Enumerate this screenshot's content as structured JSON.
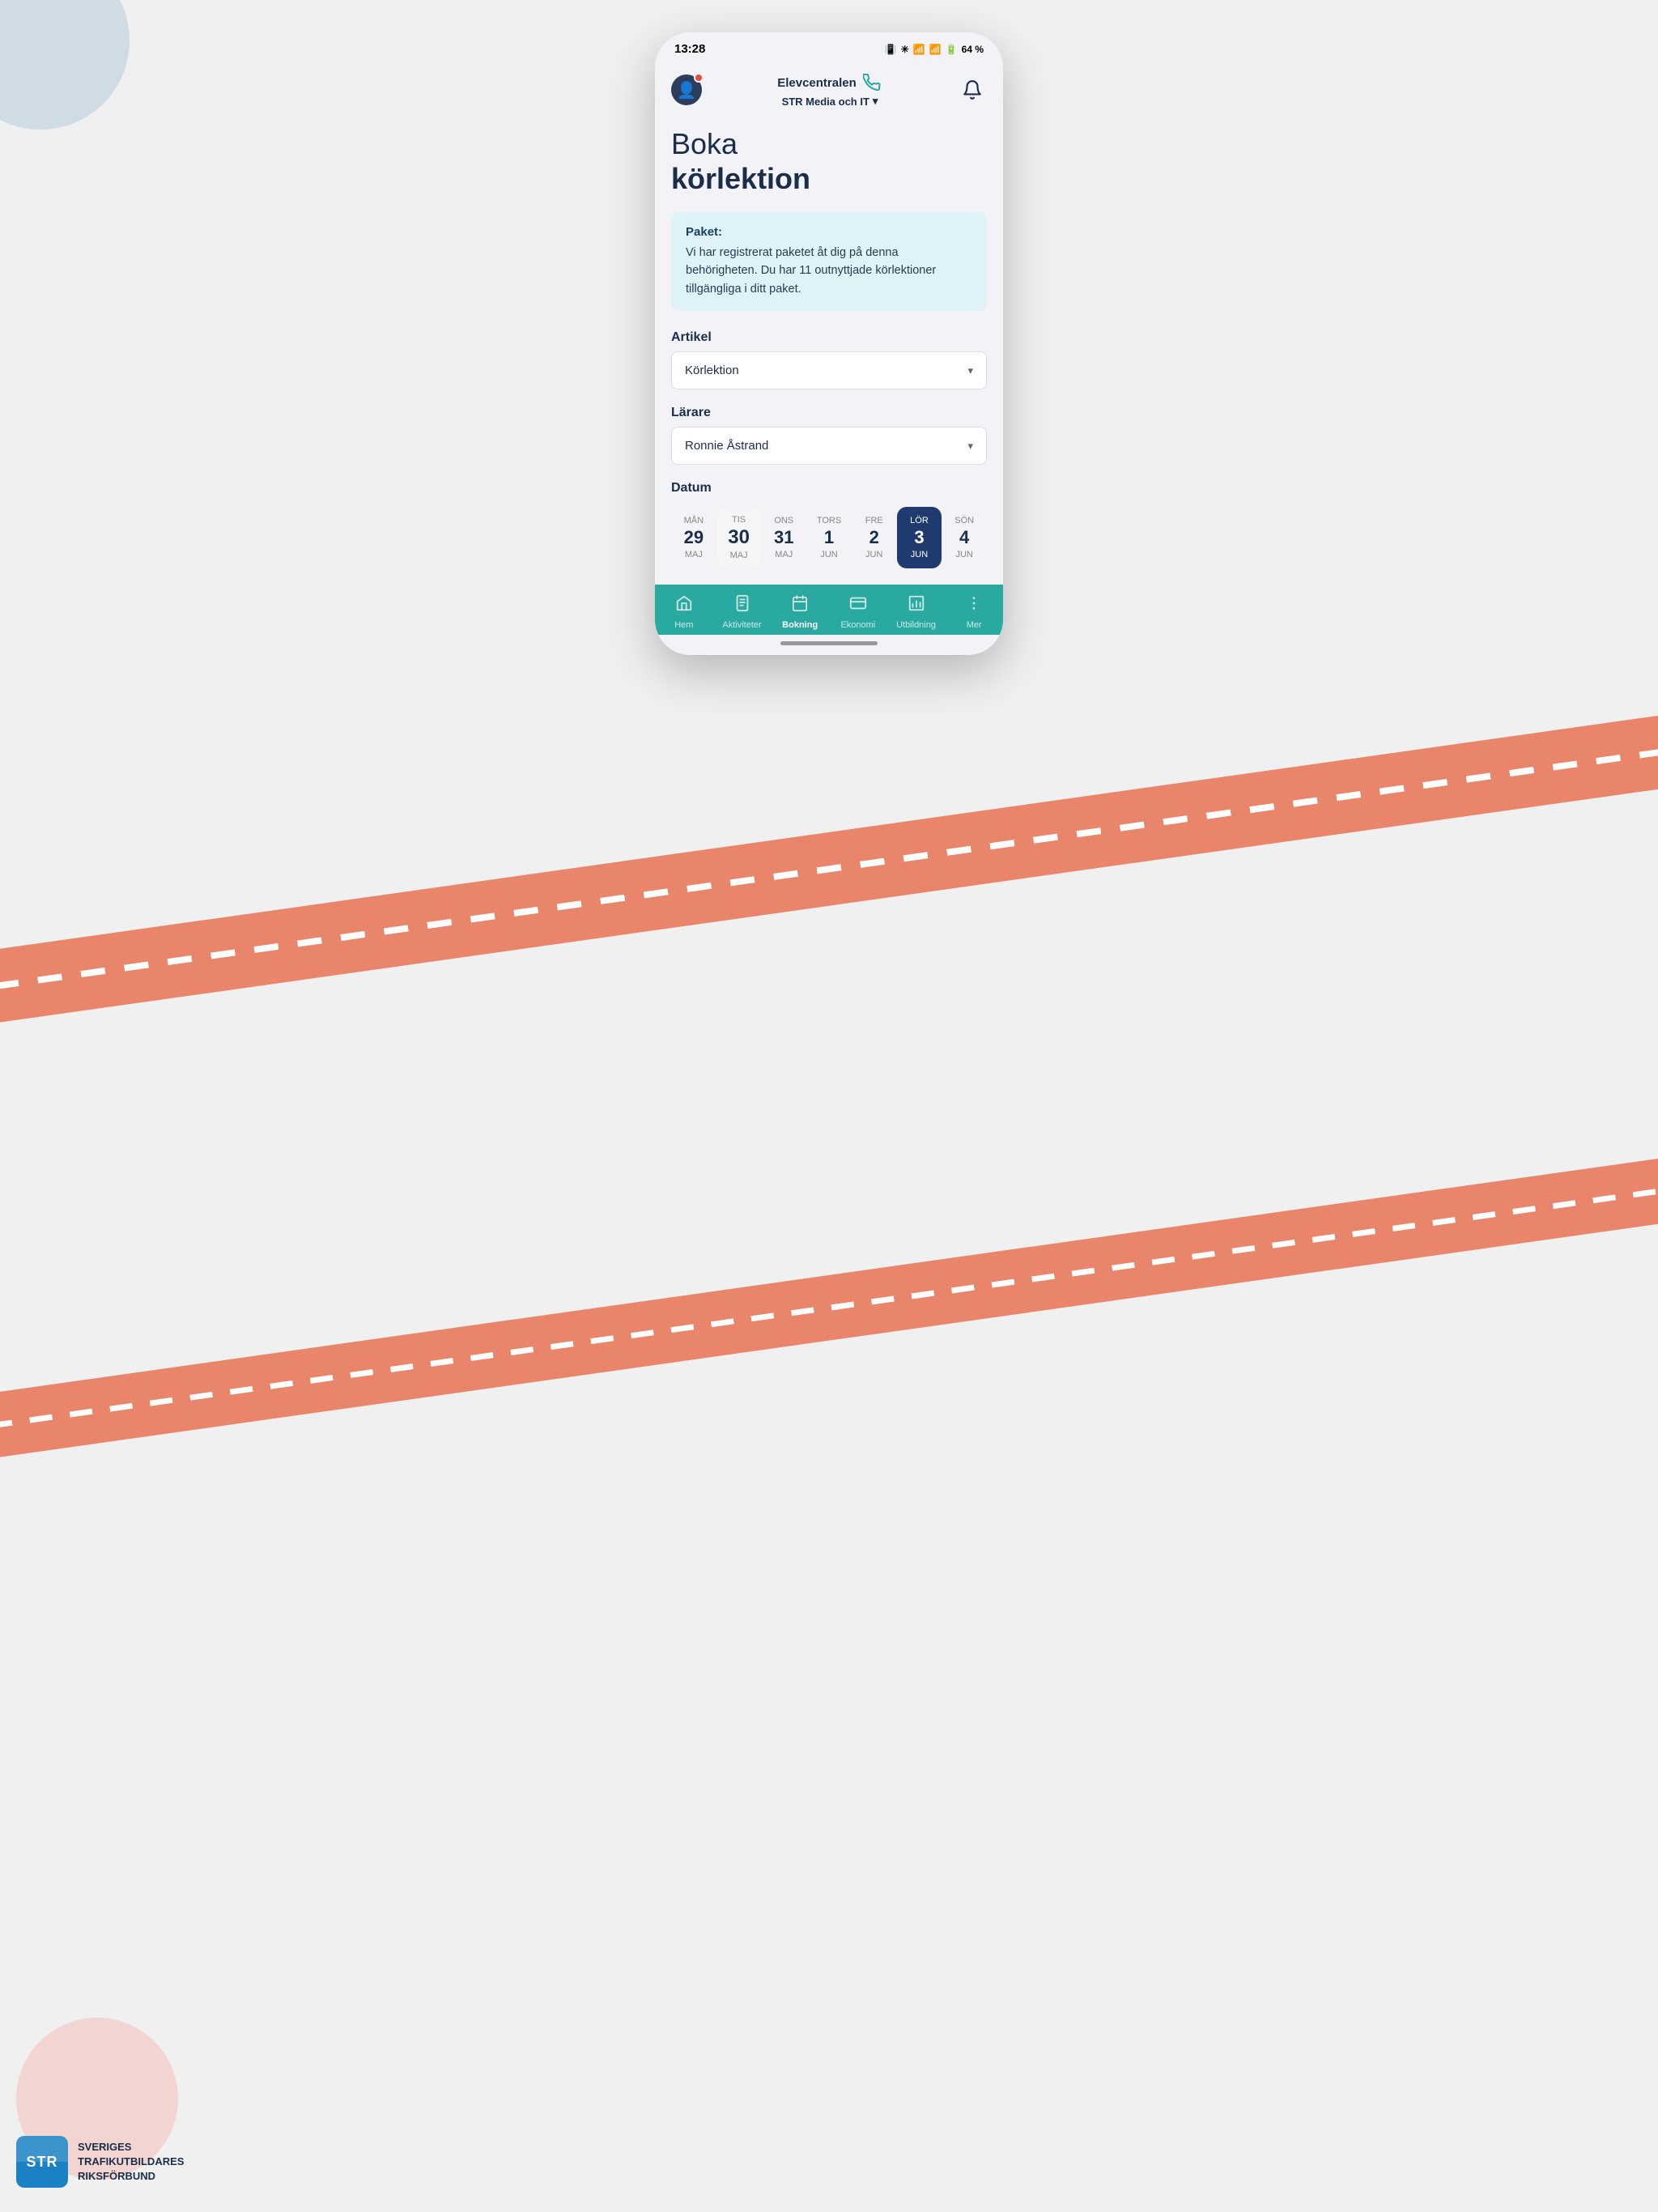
{
  "status_bar": {
    "time": "13:28",
    "battery": "64 %",
    "icons_text": "🔔 ✳ 📶 📶 🔋 64 %"
  },
  "top_nav": {
    "app_name": "Elevcentralen",
    "school_name": "STR Media och IT",
    "chevron": "∨"
  },
  "page": {
    "title_light": "Boka",
    "title_bold": "körlektion"
  },
  "info_box": {
    "title": "Paket:",
    "text": "Vi har registrerat paketet åt dig på denna behörigheten. Du har 11 outnyttjade körlektioner tillgängliga i ditt paket."
  },
  "form": {
    "article_label": "Artikel",
    "article_value": "Körlektion",
    "teacher_label": "Lärare",
    "teacher_value": "Ronnie Åstrand",
    "date_label": "Datum"
  },
  "calendar": {
    "days": [
      {
        "day_name": "MÅN",
        "num": "29",
        "month": "MAJ",
        "selected": false,
        "highlighted": false
      },
      {
        "day_name": "TIS",
        "num": "30",
        "month": "MAJ",
        "selected": false,
        "highlighted": true
      },
      {
        "day_name": "ONS",
        "num": "31",
        "month": "MAJ",
        "selected": false,
        "highlighted": false
      },
      {
        "day_name": "TORS",
        "num": "1",
        "month": "JUN",
        "selected": false,
        "highlighted": false
      },
      {
        "day_name": "FRE",
        "num": "2",
        "month": "JUN",
        "selected": false,
        "highlighted": false
      },
      {
        "day_name": "LÖR",
        "num": "3",
        "month": "JUN",
        "selected": true,
        "highlighted": false
      },
      {
        "day_name": "SÖN",
        "num": "4",
        "month": "JUN",
        "selected": false,
        "highlighted": false
      }
    ]
  },
  "bottom_nav": {
    "items": [
      {
        "label": "Hem",
        "icon": "⌂",
        "active": false
      },
      {
        "label": "Aktiviteter",
        "icon": "📋",
        "active": false
      },
      {
        "label": "Bokning",
        "icon": "📅",
        "active": true
      },
      {
        "label": "Ekonomi",
        "icon": "💳",
        "active": false
      },
      {
        "label": "Utbildning",
        "icon": "📊",
        "active": false
      },
      {
        "label": "Mer",
        "icon": "⋮",
        "active": false
      }
    ]
  },
  "str_logo": {
    "text": "STR",
    "org_line1": "SVERIGES",
    "org_line2": "TRAFIKUTBILDARES",
    "org_line3": "RIKSFÖRBUND"
  }
}
